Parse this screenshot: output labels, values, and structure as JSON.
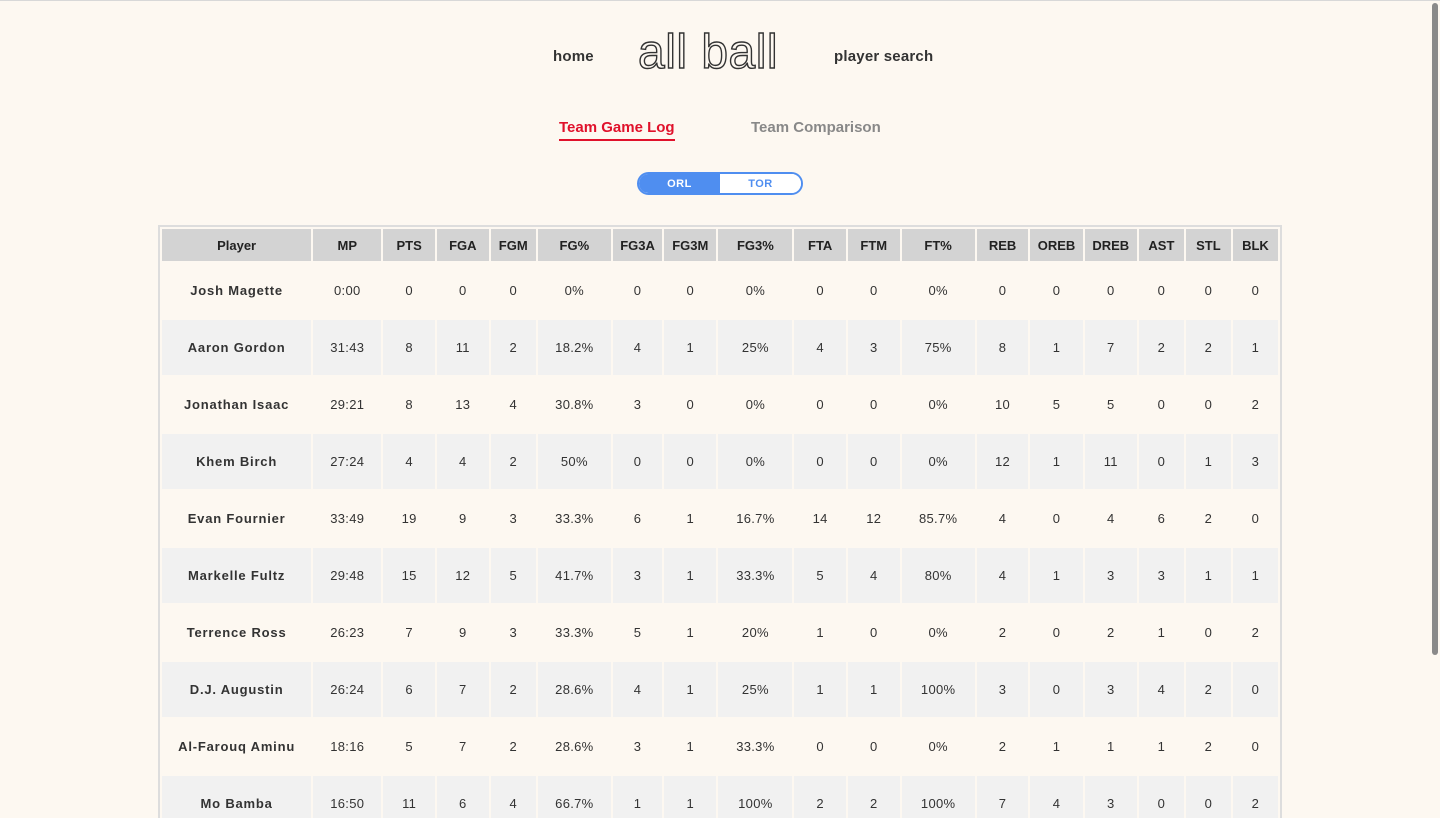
{
  "nav": {
    "home": "home",
    "logo": "all ball",
    "player_search": "player search"
  },
  "tabs": {
    "active": "Team Game Log",
    "inactive": "Team Comparison"
  },
  "toggle": {
    "selected": "ORL",
    "unselected": "TOR"
  },
  "table": {
    "columns": [
      "Player",
      "MP",
      "PTS",
      "FGA",
      "FGM",
      "FG%",
      "FG3A",
      "FG3M",
      "FG3%",
      "FTA",
      "FTM",
      "FT%",
      "REB",
      "OREB",
      "DREB",
      "AST",
      "STL",
      "BLK"
    ],
    "rows": [
      [
        "Josh Magette",
        "0:00",
        "0",
        "0",
        "0",
        "0%",
        "0",
        "0",
        "0%",
        "0",
        "0",
        "0%",
        "0",
        "0",
        "0",
        "0",
        "0",
        "0"
      ],
      [
        "Aaron Gordon",
        "31:43",
        "8",
        "11",
        "2",
        "18.2%",
        "4",
        "1",
        "25%",
        "4",
        "3",
        "75%",
        "8",
        "1",
        "7",
        "2",
        "2",
        "1"
      ],
      [
        "Jonathan Isaac",
        "29:21",
        "8",
        "13",
        "4",
        "30.8%",
        "3",
        "0",
        "0%",
        "0",
        "0",
        "0%",
        "10",
        "5",
        "5",
        "0",
        "0",
        "2"
      ],
      [
        "Khem Birch",
        "27:24",
        "4",
        "4",
        "2",
        "50%",
        "0",
        "0",
        "0%",
        "0",
        "0",
        "0%",
        "12",
        "1",
        "11",
        "0",
        "1",
        "3"
      ],
      [
        "Evan Fournier",
        "33:49",
        "19",
        "9",
        "3",
        "33.3%",
        "6",
        "1",
        "16.7%",
        "14",
        "12",
        "85.7%",
        "4",
        "0",
        "4",
        "6",
        "2",
        "0"
      ],
      [
        "Markelle Fultz",
        "29:48",
        "15",
        "12",
        "5",
        "41.7%",
        "3",
        "1",
        "33.3%",
        "5",
        "4",
        "80%",
        "4",
        "1",
        "3",
        "3",
        "1",
        "1"
      ],
      [
        "Terrence Ross",
        "26:23",
        "7",
        "9",
        "3",
        "33.3%",
        "5",
        "1",
        "20%",
        "1",
        "0",
        "0%",
        "2",
        "0",
        "2",
        "1",
        "0",
        "2"
      ],
      [
        "D.J. Augustin",
        "26:24",
        "6",
        "7",
        "2",
        "28.6%",
        "4",
        "1",
        "25%",
        "1",
        "1",
        "100%",
        "3",
        "0",
        "3",
        "4",
        "2",
        "0"
      ],
      [
        "Al-Farouq Aminu",
        "18:16",
        "5",
        "7",
        "2",
        "28.6%",
        "3",
        "1",
        "33.3%",
        "0",
        "0",
        "0%",
        "2",
        "1",
        "1",
        "1",
        "2",
        "0"
      ],
      [
        "Mo Bamba",
        "16:50",
        "11",
        "6",
        "4",
        "66.7%",
        "1",
        "1",
        "100%",
        "2",
        "2",
        "100%",
        "7",
        "4",
        "3",
        "0",
        "0",
        "2"
      ]
    ]
  },
  "colors": {
    "background": "#fdf8f1",
    "accent_red": "#e0112b",
    "toggle_blue": "#4f8ef0",
    "header_gray": "#d3d3d3",
    "row_alt": "#f1f1f1"
  }
}
